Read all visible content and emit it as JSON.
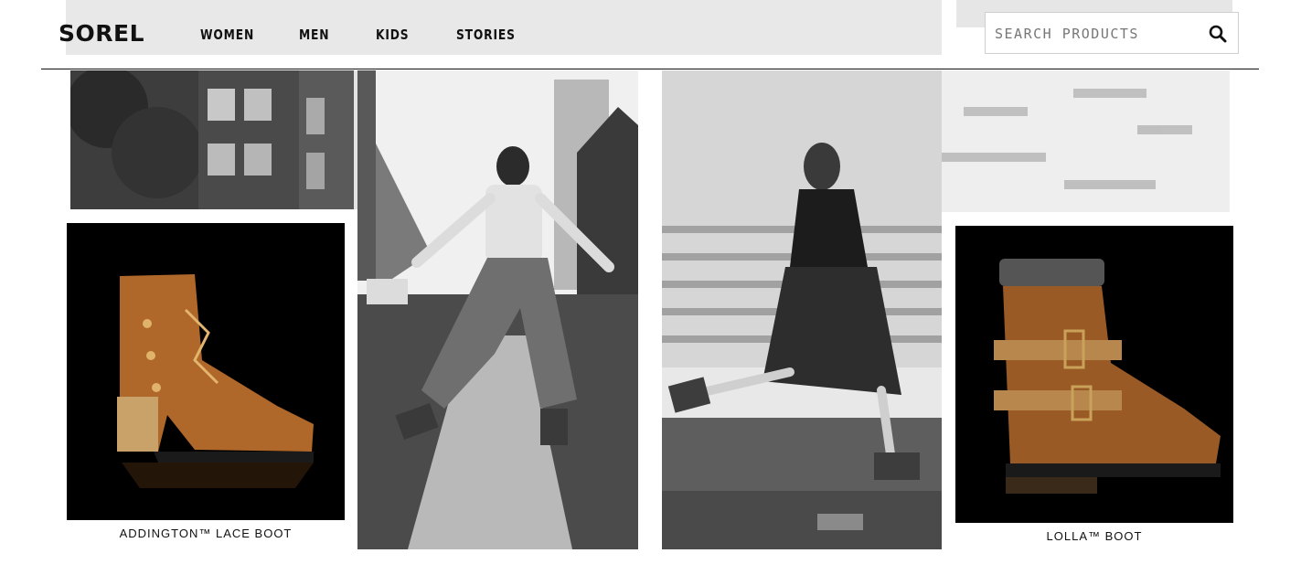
{
  "header": {
    "logo": "SOREL",
    "nav": [
      "WOMEN",
      "MEN",
      "KIDS",
      "STORIES"
    ],
    "search_placeholder": "SEARCH PRODUCTS",
    "search_icon": "search-icon"
  },
  "products": [
    {
      "name": "ADDINGTON™ LACE BOOT",
      "color": "#b0672a"
    },
    {
      "name": "LOLLA™ BOOT",
      "color": "#9a5a26"
    }
  ],
  "colors": {
    "accent": "#111111",
    "boot_leather": "#a9652a",
    "photo_bg": "#000000"
  }
}
